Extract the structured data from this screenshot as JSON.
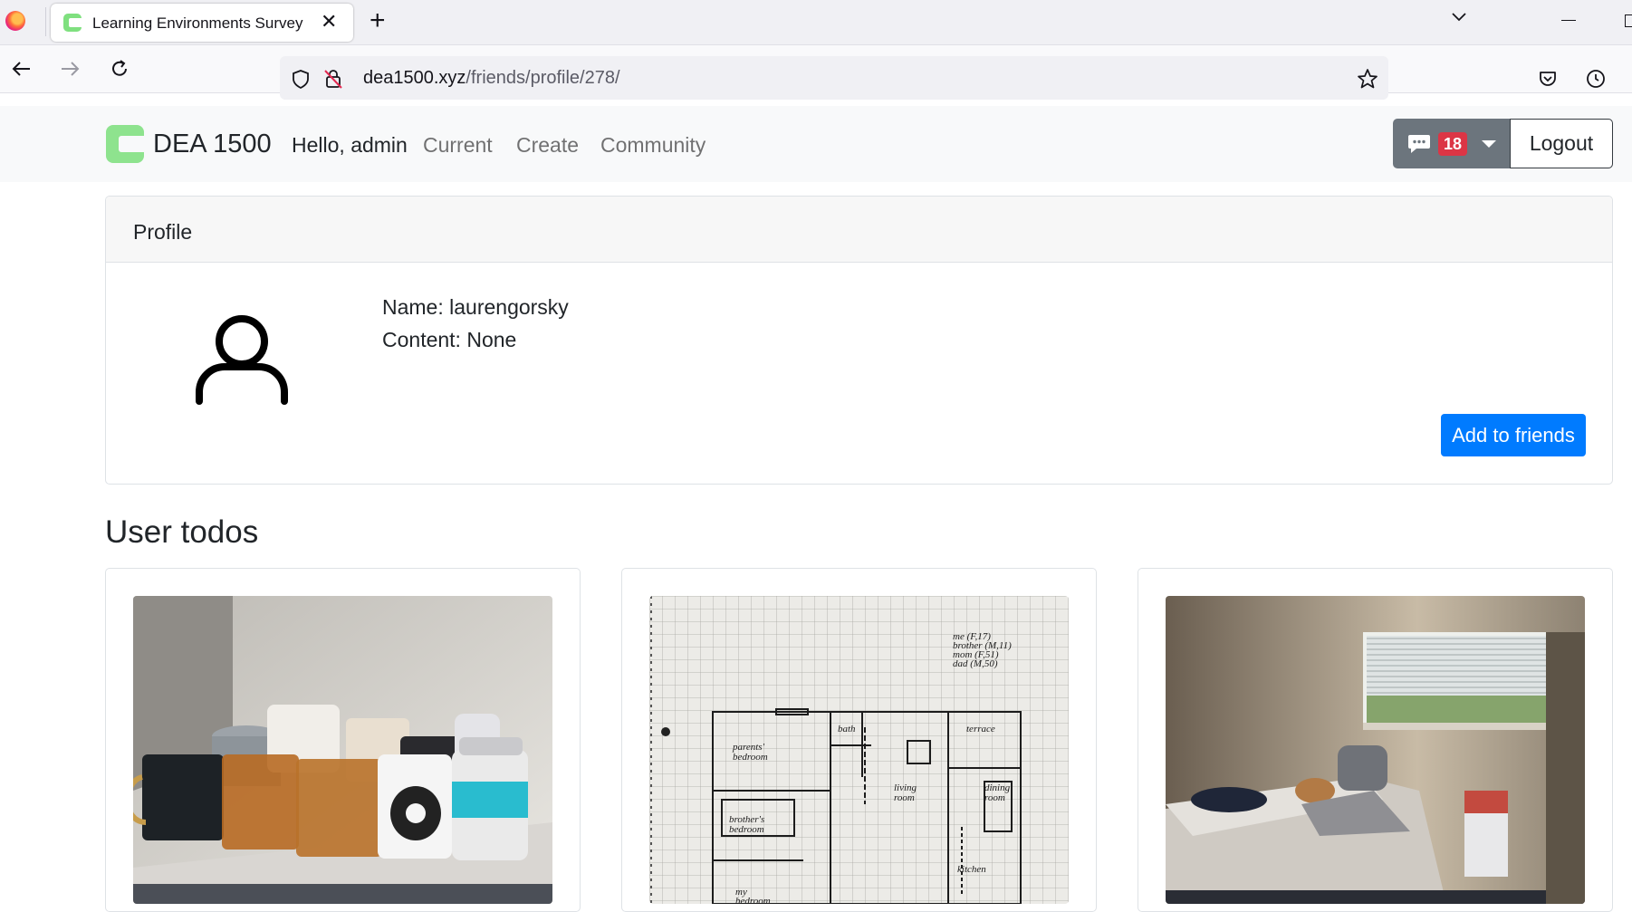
{
  "browser": {
    "tab_title": "Learning Environments Survey",
    "tab_close": "✕",
    "new_tab": "+",
    "url_domain": "dea1500.xyz",
    "url_path": "/friends/profile/278/"
  },
  "site": {
    "brand": "DEA 1500",
    "greeting": "Hello, admin",
    "nav": [
      "Current",
      "Create",
      "Community"
    ],
    "messages_count": "18",
    "logout_label": "Logout"
  },
  "profile": {
    "header": "Profile",
    "name_line": "Name: laurengorsky",
    "content_line": "Content: None",
    "add_friend_label": "Add to friends"
  },
  "todos": {
    "title": "User todos",
    "items": [
      {
        "image": "mugs-on-shelf-photo"
      },
      {
        "image": "floor-plan-sketch-photo"
      },
      {
        "image": "bedroom-photo"
      }
    ]
  },
  "colors": {
    "primary": "#007bff",
    "secondary": "#6c757d",
    "danger": "#dc3545",
    "brand_green": "#8ee38e"
  }
}
